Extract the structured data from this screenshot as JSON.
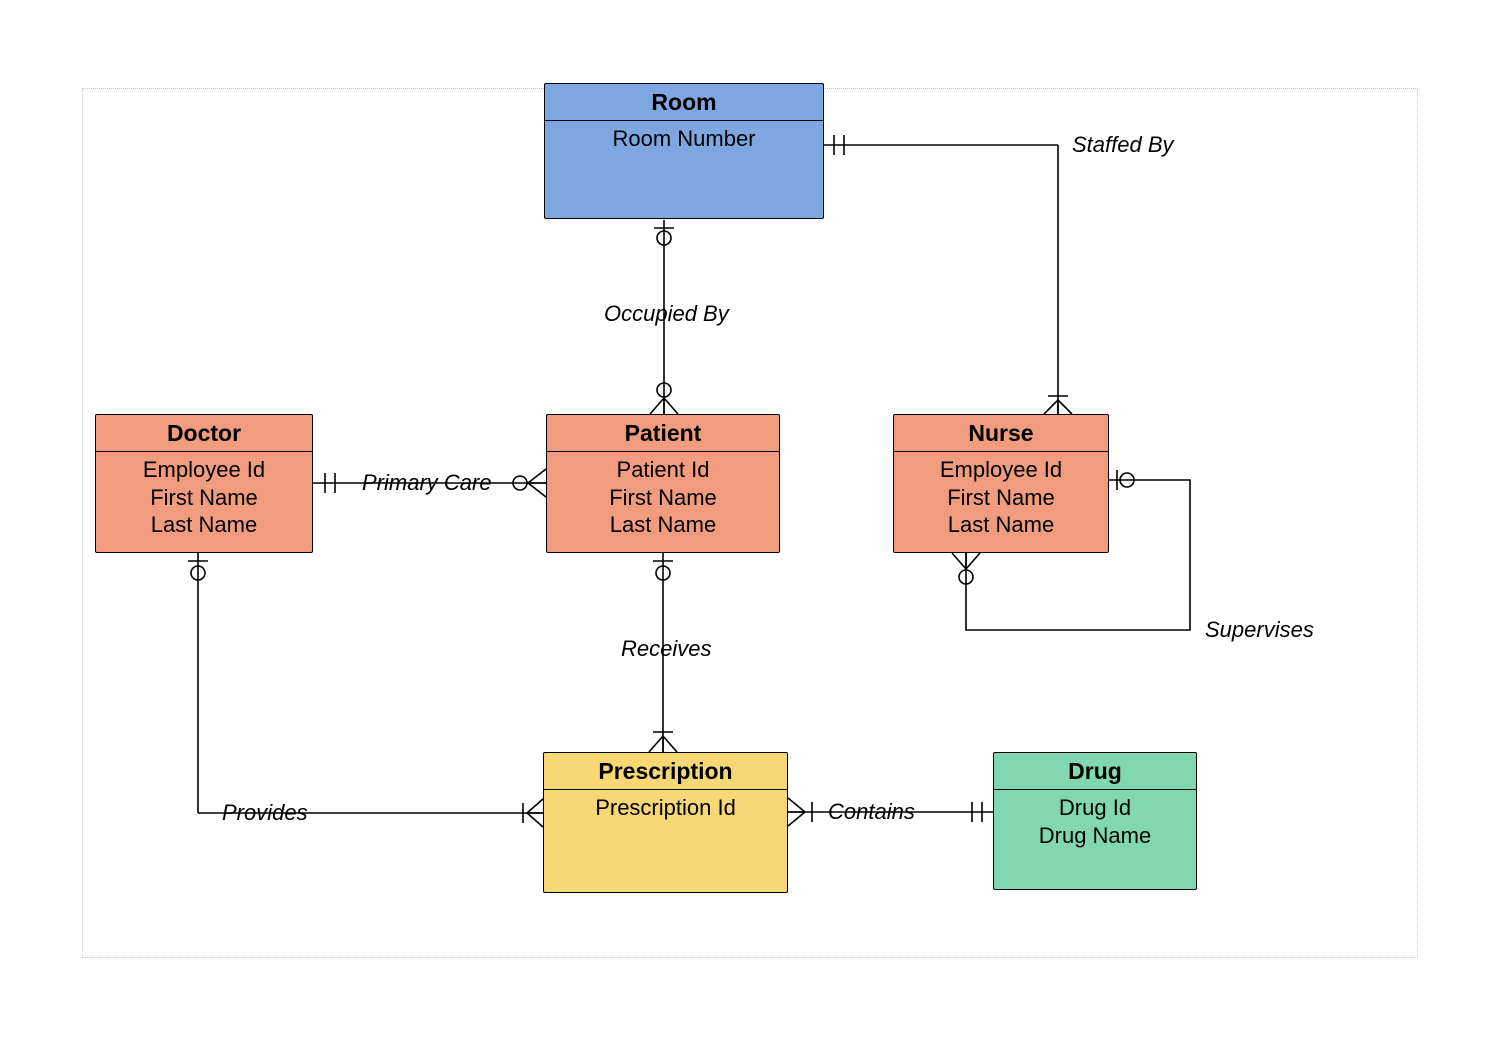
{
  "entities": {
    "room": {
      "title": "Room",
      "attrs": [
        "Room Number"
      ]
    },
    "doctor": {
      "title": "Doctor",
      "attrs": [
        "Employee Id",
        "First Name",
        "Last Name"
      ]
    },
    "patient": {
      "title": "Patient",
      "attrs": [
        "Patient Id",
        "First Name",
        "Last Name"
      ]
    },
    "nurse": {
      "title": "Nurse",
      "attrs": [
        "Employee Id",
        "First Name",
        "Last Name"
      ]
    },
    "prescription": {
      "title": "Prescription",
      "attrs": [
        "Prescription Id"
      ]
    },
    "drug": {
      "title": "Drug",
      "attrs": [
        "Drug Id",
        "Drug Name"
      ]
    }
  },
  "relationships": {
    "staffed_by": "Staffed By",
    "occupied_by": "Occupied By",
    "primary_care": "Primary Care",
    "receives": "Receives",
    "provides": "Provides",
    "contains": "Contains",
    "supervises": "Supervises"
  }
}
